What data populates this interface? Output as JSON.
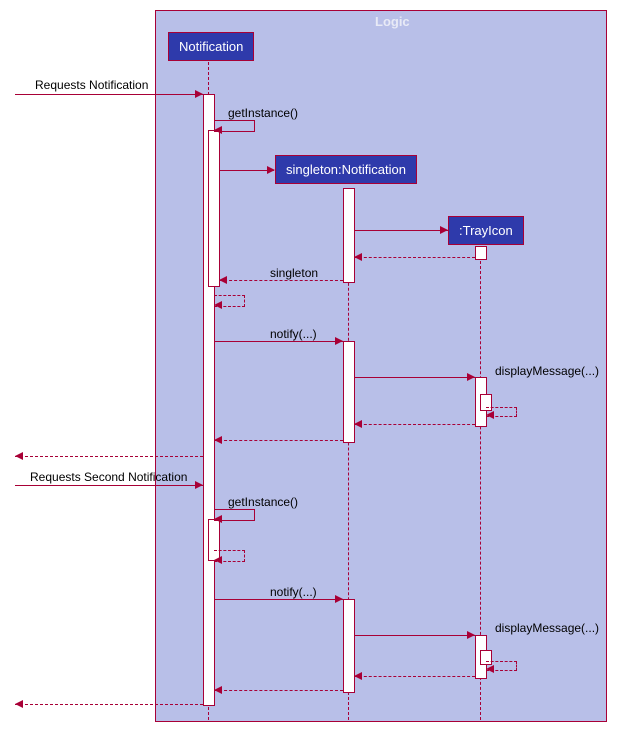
{
  "chart_data": {
    "type": "sequence_diagram",
    "container": {
      "name": "Logic"
    },
    "participants": [
      {
        "id": "notification",
        "label": "Notification",
        "kind": "class"
      },
      {
        "id": "singleton",
        "label": "singleton:Notification",
        "kind": "object",
        "created_at_step": 2
      },
      {
        "id": "trayicon",
        "label": ":TrayIcon",
        "kind": "object",
        "created_at_step": 3
      }
    ],
    "external_actor": true,
    "messages": [
      {
        "step": 1,
        "from": "external",
        "to": "notification",
        "label": "Requests Notification",
        "type": "sync"
      },
      {
        "step": 2,
        "from": "notification",
        "to": "notification",
        "label": "getInstance()",
        "type": "self"
      },
      {
        "step": 3,
        "from": "notification",
        "to": "singleton",
        "label": "",
        "type": "create"
      },
      {
        "step": 4,
        "from": "singleton",
        "to": "trayicon",
        "label": "",
        "type": "create"
      },
      {
        "step": 5,
        "from": "trayicon",
        "to": "singleton",
        "label": "",
        "type": "return"
      },
      {
        "step": 6,
        "from": "singleton",
        "to": "notification",
        "label": "singleton",
        "type": "return"
      },
      {
        "step": 7,
        "from": "notification",
        "to": "notification",
        "label": "",
        "type": "self_return"
      },
      {
        "step": 8,
        "from": "notification",
        "to": "singleton",
        "label": "notify(...)",
        "type": "sync"
      },
      {
        "step": 9,
        "from": "singleton",
        "to": "trayicon",
        "label": "displayMessage(...)",
        "type": "sync"
      },
      {
        "step": 10,
        "from": "trayicon",
        "to": "trayicon",
        "label": "",
        "type": "self_return"
      },
      {
        "step": 11,
        "from": "trayicon",
        "to": "singleton",
        "label": "",
        "type": "return"
      },
      {
        "step": 12,
        "from": "singleton",
        "to": "notification",
        "label": "",
        "type": "return"
      },
      {
        "step": 13,
        "from": "notification",
        "to": "external",
        "label": "",
        "type": "return"
      },
      {
        "step": 14,
        "from": "external",
        "to": "notification",
        "label": "Requests Second Notification",
        "type": "sync"
      },
      {
        "step": 15,
        "from": "notification",
        "to": "notification",
        "label": "getInstance()",
        "type": "self"
      },
      {
        "step": 16,
        "from": "notification",
        "to": "notification",
        "label": "",
        "type": "self_return"
      },
      {
        "step": 17,
        "from": "notification",
        "to": "singleton",
        "label": "notify(...)",
        "type": "sync"
      },
      {
        "step": 18,
        "from": "singleton",
        "to": "trayicon",
        "label": "displayMessage(...)",
        "type": "sync"
      },
      {
        "step": 19,
        "from": "trayicon",
        "to": "trayicon",
        "label": "",
        "type": "self_return"
      },
      {
        "step": 20,
        "from": "trayicon",
        "to": "singleton",
        "label": "",
        "type": "return"
      },
      {
        "step": 21,
        "from": "singleton",
        "to": "notification",
        "label": "",
        "type": "return"
      },
      {
        "step": 22,
        "from": "notification",
        "to": "external",
        "label": "",
        "type": "return"
      }
    ]
  },
  "labels": {
    "container": "Logic",
    "p1": "Notification",
    "p2": "singleton:Notification",
    "p3": ":TrayIcon",
    "m1": "Requests Notification",
    "m2": "getInstance()",
    "m6": "singleton",
    "m8": "notify(...)",
    "m9": "displayMessage(...)",
    "m14": "Requests Second Notification",
    "m15": "getInstance()",
    "m17": "notify(...)",
    "m18": "displayMessage(...)"
  }
}
